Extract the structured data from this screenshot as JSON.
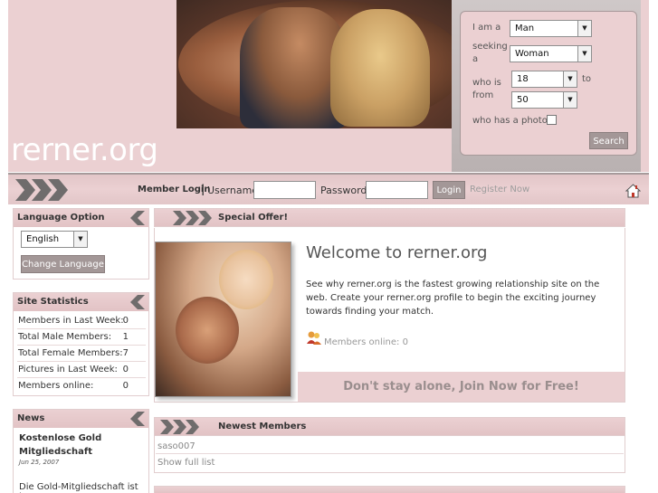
{
  "header": {
    "logo_text": "rerner.org"
  },
  "search": {
    "i_am_label": "I am a",
    "i_am_value": "Man",
    "seeking_label_1": "seeking",
    "seeking_label_2": "a",
    "seeking_value": "Woman",
    "who_is_label_1": "who is",
    "who_is_label_2": "from",
    "age_from": "18",
    "to_label": "to",
    "age_to": "50",
    "photo_label": "who has a photo",
    "search_button": "Search"
  },
  "login": {
    "title": "Member Login",
    "separator": "|",
    "username_label": "Username:",
    "password_label": "Password:",
    "login_button": "Login",
    "register_link": "Register Now",
    "home_icon": "home-icon"
  },
  "sidebar": {
    "language": {
      "title": "Language Option",
      "selected": "English",
      "button": "Change Language"
    },
    "stats": {
      "title": "Site Statistics",
      "rows": [
        {
          "label": "Members in Last Week:",
          "value": "0"
        },
        {
          "label": "Total Male Members:",
          "value": "1"
        },
        {
          "label": "Total Female Members:",
          "value": "7"
        },
        {
          "label": "Pictures in Last Week:",
          "value": "0"
        },
        {
          "label": "Members online:",
          "value": "0"
        }
      ]
    },
    "news": {
      "title": "News",
      "headline": "Kostenlose Gold Mitgliedschaft",
      "date": "Jun 25, 2007",
      "body": "Die Gold-Mitgliedschaft ist jetzt"
    }
  },
  "main": {
    "special_offer_title": "Special Offer!",
    "welcome_title": "Welcome to rerner.org",
    "welcome_text": "See why rerner.org is the fastest growing relationship site on the web. Create your rerner.org profile to begin the exciting journey towards finding your match.",
    "members_online": "Members online: 0",
    "join_text": "Don't stay alone, Join Now for Free!",
    "newest_title": "Newest Members",
    "newest_member": "saso007",
    "show_full": "Show full list"
  },
  "colors": {
    "panel_pink": "#ebd0d2",
    "button_gray": "#a39797",
    "chevron_gray": "#6f6c6c"
  }
}
